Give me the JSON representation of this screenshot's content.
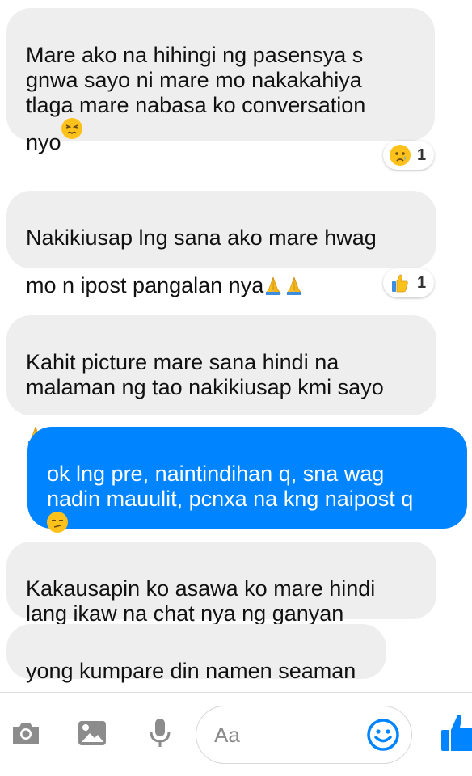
{
  "messages": [
    {
      "text": "Mare ako na hihingi ng pasensya s\ngnwa sayo ni mare mo nakakahiya\ntlaga mare nabasa ko conversation\nnyo",
      "emoji": "persevering-face",
      "reaction": {
        "emoji": "crying-face",
        "count": "1"
      }
    },
    {
      "text": "Nakikiusap lng sana ako mare hwag\nmo n ipost pangalan nya",
      "emoji": "praying-hands x2",
      "reaction": {
        "emoji": "thumbs-up",
        "count": "1"
      }
    },
    {
      "text": "Kahit picture mare sana hindi na\nmalaman ng tao nakikiusap kmi sayo\n",
      "emoji": "praying-hands"
    },
    {
      "text": "ok lng pre, naintindihan q, sna wag\nnadin mauulit, pcnxa na kng naipost q\n",
      "emoji": "unamused-face"
    },
    {
      "text": "Kakausapin ko asawa ko mare hindi\nlang ikaw na chat nya ng ganyan"
    },
    {
      "text": "yong kumpare din namen seaman"
    }
  ],
  "composer": {
    "placeholder": "Aa",
    "icons": [
      "camera-icon",
      "image-icon",
      "microphone-icon",
      "emoji-icon",
      "thumbs-up-icon"
    ]
  },
  "colors": {
    "outgoing_bubble": "#0084ff",
    "incoming_bubble": "#eeeeee",
    "icon_gray": "#8c8c8c",
    "accent": "#0084ff"
  }
}
